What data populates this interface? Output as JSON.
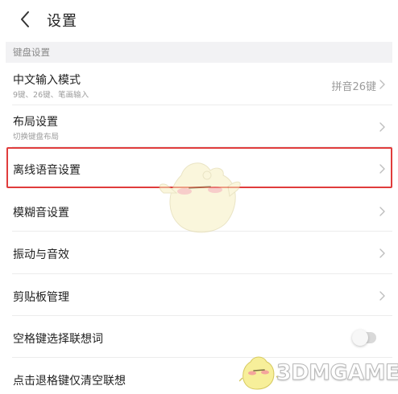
{
  "topbar": {
    "back_icon": "chevron-left-icon",
    "title": "设置"
  },
  "section": {
    "label": "键盘设置"
  },
  "rows": [
    {
      "title": "中文输入模式",
      "subtitle": "9键、26键、笔画输入",
      "value": "拼音26键",
      "control": "chevron"
    },
    {
      "title": "布局设置",
      "subtitle": "切换键盘布局",
      "value": "",
      "control": "chevron"
    },
    {
      "title": "离线语音设置",
      "subtitle": "",
      "value": "",
      "control": "chevron",
      "highlighted": true
    },
    {
      "title": "模糊音设置",
      "subtitle": "",
      "value": "",
      "control": "chevron"
    },
    {
      "title": "振动与音效",
      "subtitle": "",
      "value": "",
      "control": "chevron"
    },
    {
      "title": "剪贴板管理",
      "subtitle": "",
      "value": "",
      "control": "chevron"
    },
    {
      "title": "空格键选择联想词",
      "subtitle": "",
      "value": "",
      "control": "toggle",
      "toggle_on": false
    },
    {
      "title": "点击退格键仅清空联想",
      "subtitle": "",
      "value": "",
      "control": "toggle"
    }
  ],
  "watermark": {
    "text": "3DMGAME"
  },
  "colors": {
    "highlight": "#e03c3c",
    "section_bg": "#f2f2f4",
    "secondary_text": "#9b9b9b"
  }
}
